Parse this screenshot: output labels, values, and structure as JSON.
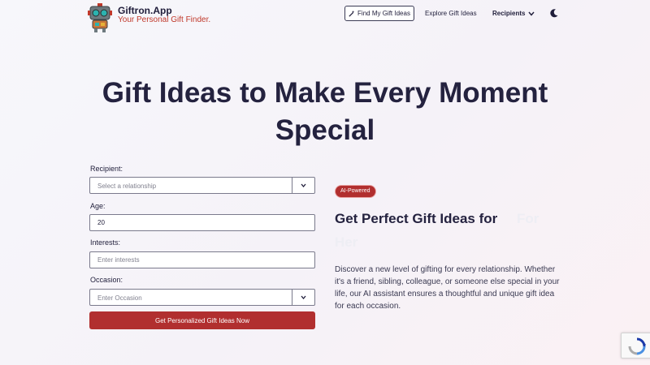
{
  "header": {
    "brand_name": "Giftron.App",
    "brand_tagline": "Your Personal Gift Finder.",
    "nav": {
      "find_my_gift_ideas": "Find My Gift Ideas",
      "explore_gift_ideas": "Explore Gift Ideas",
      "recipients": "Recipients"
    }
  },
  "hero": {
    "title_line1": "Gift Ideas to Make Every Moment",
    "title_line2": "Special"
  },
  "form": {
    "recipient_label": "Recipient:",
    "recipient_placeholder": "Select a relationship",
    "age_label": "Age:",
    "age_value": "20",
    "interests_label": "Interests:",
    "interests_placeholder": "Enter interests",
    "occasion_label": "Occasion:",
    "occasion_placeholder": "Enter Occasion",
    "submit_label": "Get Personalized Gift Ideas Now"
  },
  "promo": {
    "badge": "AI-Powered",
    "headline_main": "Get Perfect Gift Ideas for",
    "headline_fade_a": "For",
    "headline_fade_b": "Her",
    "description": "Discover a new level of gifting for every relationship. Whether it's a friend, sibling, colleague, or someone else special in your life, our AI assistant ensures a thoughtful and unique gift idea for each occasion."
  },
  "colors": {
    "accent": "#b12f2f",
    "tagline": "#c0392b",
    "text_dark": "#24223f"
  },
  "icons": {
    "logo": "robot-logo-icon",
    "find_button": "magic-wand-icon",
    "recipients_dropdown": "chevron-down-icon",
    "theme_toggle": "moon-icon",
    "select_dropdown": "chevron-down-icon",
    "recaptcha": "recaptcha-icon"
  }
}
